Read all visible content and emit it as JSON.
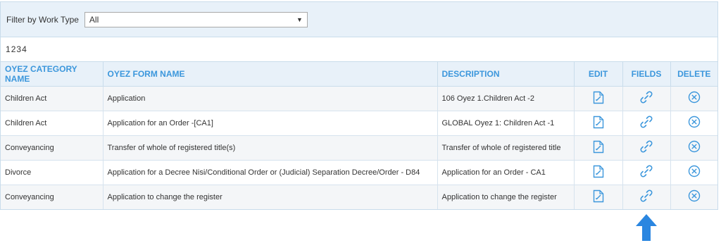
{
  "filter": {
    "label": "Filter by Work Type",
    "selected": "All"
  },
  "pager": {
    "pages": [
      "1",
      "2",
      "3",
      "4"
    ]
  },
  "table": {
    "headers": {
      "category": "OYEZ CATEGORY NAME",
      "form": "OYEZ FORM NAME",
      "description": "DESCRIPTION",
      "edit": "EDIT",
      "fields": "FIELDS",
      "delete": "DELETE"
    },
    "rows": [
      {
        "category": "Children Act",
        "form": "Application",
        "description": "106 Oyez 1.Children Act -2"
      },
      {
        "category": "Children Act",
        "form": "Application for an Order -[CA1]",
        "description": "GLOBAL Oyez 1: Children Act -1"
      },
      {
        "category": "Conveyancing",
        "form": "Transfer of whole of registered title(s)",
        "description": "Transfer of whole of registered title"
      },
      {
        "category": "Divorce",
        "form": "Application for a Decree Nisi/Conditional Order or (Judicial) Separation Decree/Order - D84",
        "description": "Application for an Order - CA1"
      },
      {
        "category": "Conveyancing",
        "form": "Application to change the register",
        "description": "Application to change the register"
      }
    ]
  },
  "icons": {
    "edit": "edit-document-icon",
    "fields": "link-icon",
    "delete": "circle-x-icon",
    "pointer": "up-arrow-icon"
  },
  "colors": {
    "accent": "#3c97dc",
    "header_bg": "#e8f1f9",
    "arrow": "#2a86e0"
  }
}
